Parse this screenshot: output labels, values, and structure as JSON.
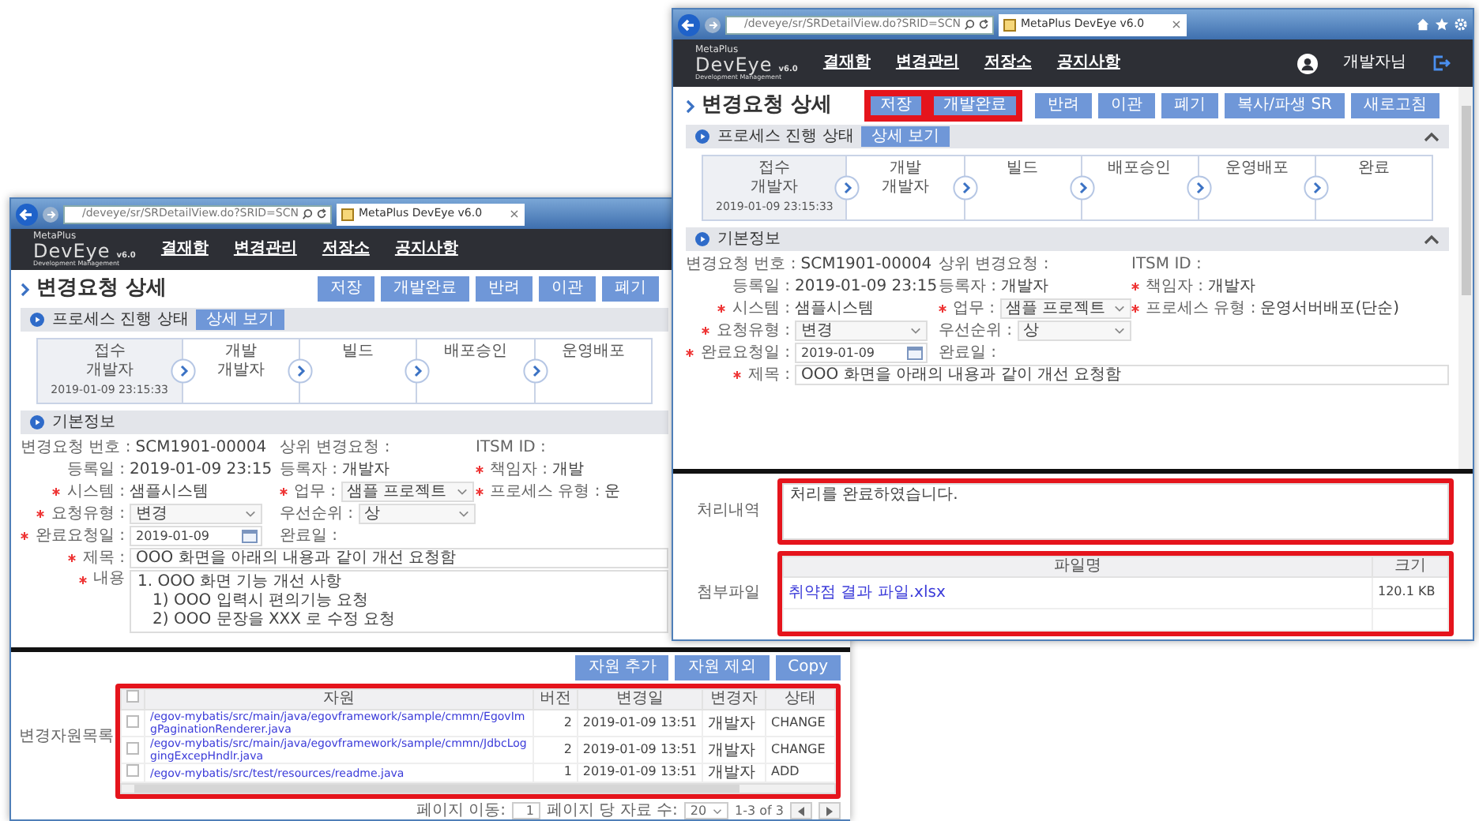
{
  "back_window": {
    "browser": {
      "url": "/deveye/sr/SRDetailView.do?SRID=SCN",
      "tab_title": "MetaPlus DevEye v6.0",
      "tab_close": "×"
    },
    "header": {
      "brand": "MetaPlus",
      "product": "DevEye",
      "version": "v6.0",
      "tagline": "Development Management",
      "menu": [
        "결재함",
        "변경관리",
        "저장소",
        "공지사항"
      ]
    },
    "page_title": "변경요청 상세",
    "actions": [
      {
        "label": "저장",
        "highlighted": false
      },
      {
        "label": "개발완료",
        "highlighted": false
      },
      {
        "label": "반려",
        "highlighted": false
      },
      {
        "label": "이관",
        "highlighted": false
      },
      {
        "label": "폐기",
        "highlighted": false
      }
    ],
    "process": {
      "title": "프로세스 진행 상태",
      "detail_button": "상세 보기",
      "collapsible": false,
      "steps": [
        {
          "name": "접수",
          "actor": "개발자",
          "time": "2019-01-09 23:15:33",
          "current": true
        },
        {
          "name": "개발",
          "actor": "개발자",
          "current": false
        },
        {
          "name": "빌드",
          "current": false
        },
        {
          "name": "배포승인",
          "current": false
        },
        {
          "name": "운영배포",
          "current": false
        }
      ]
    },
    "basic_info": {
      "title": "기본정보",
      "collapsible": false,
      "rows": [
        [
          {
            "label": "변경요청 번호 :",
            "value": "SCM1901-00004",
            "kind": "text",
            "required": false
          },
          {
            "label": "상위 변경요청 :",
            "kind": "text",
            "required": false
          },
          {
            "label": "ITSM ID :",
            "kind": "text",
            "required": false
          }
        ],
        [
          {
            "label": "등록일 :",
            "value": "2019-01-09 23:15",
            "kind": "text",
            "required": false
          },
          {
            "label": "등록자 :",
            "value": "개발자",
            "kind": "text",
            "required": false
          },
          {
            "label": "책임자 :",
            "value": "개발",
            "kind": "text",
            "required": true
          }
        ],
        [
          {
            "label": "시스템 :",
            "value": "샘플시스템",
            "kind": "text",
            "required": true
          },
          {
            "label": "업무 :",
            "value": "샘플 프로젝트",
            "kind": "select",
            "required": true
          },
          {
            "label": "프로세스 유형 :",
            "value": "운",
            "kind": "text",
            "required": true
          }
        ],
        [
          {
            "label": "요청유형 :",
            "value": "변경",
            "kind": "select",
            "required": true
          },
          {
            "label": "우선순위 :",
            "value": "상",
            "kind": "select",
            "required": false
          }
        ],
        [
          {
            "label": "완료요청일 :",
            "value": "2019-01-09",
            "kind": "date",
            "required": true
          },
          {
            "label": "완료일 :",
            "kind": "text",
            "required": false
          }
        ],
        [
          {
            "label": "제목 :",
            "value": "OOO 화면을 아래의 내용과 같이 개선 요청함",
            "kind": "input",
            "required": true
          }
        ],
        [
          {
            "label": "내용",
            "lines": [
              "1. OOO 화면 기능 개선 사항",
              "   1) OOO 입력시 편의기능 요청",
              "   2) OOO 문장을 XXX 로 수정 요청"
            ],
            "kind": "textarea",
            "required": true
          }
        ]
      ]
    },
    "resources": {
      "label": "변경자원목록",
      "buttons": [
        "자원 추가",
        "자원 제외",
        "Copy"
      ],
      "all_checked": false,
      "columns": [
        "자원",
        "버전",
        "변경일",
        "변경자",
        "상태"
      ],
      "highlighted": true,
      "rows": [
        {
          "checked": false,
          "path": "/egov-mybatis/src/main/java/egovframework/sample/cmmn/EgovImgPaginationRenderer.java",
          "version": "2",
          "changed": "2019-01-09 13:51",
          "author": "개발자",
          "status": "CHANGE"
        },
        {
          "checked": false,
          "path": "/egov-mybatis/src/main/java/egovframework/sample/cmmn/JdbcLoggingExcepHndlr.java",
          "version": "2",
          "changed": "2019-01-09 13:51",
          "author": "개발자",
          "status": "CHANGE"
        },
        {
          "checked": false,
          "path": "/egov-mybatis/src/test/resources/readme.java",
          "version": "1",
          "changed": "2019-01-09 13:51",
          "author": "개발자",
          "status": "ADD"
        }
      ],
      "pager": {
        "goto_label": "페이지 이동:",
        "page": "1",
        "per_page_label": "페이지 당 자료 수:",
        "per_page": "20",
        "range": "1-3 of 3"
      }
    }
  },
  "front_window": {
    "browser": {
      "url": "/deveye/sr/SRDetailView.do?SRID=SCN",
      "tab_title": "MetaPlus DevEye v6.0",
      "tab_close": "×"
    },
    "header": {
      "brand": "MetaPlus",
      "product": "DevEye",
      "version": "v6.0",
      "tagline": "Development Management",
      "menu": [
        "결재함",
        "변경관리",
        "저장소",
        "공지사항"
      ],
      "user": "개발자님"
    },
    "page_title": "변경요청 상세",
    "actions": [
      {
        "label": "저장",
        "highlighted": true
      },
      {
        "label": "개발완료",
        "highlighted": true
      },
      {
        "label": "반려",
        "highlighted": false
      },
      {
        "label": "이관",
        "highlighted": false
      },
      {
        "label": "폐기",
        "highlighted": false
      },
      {
        "label": "복사/파생 SR",
        "highlighted": false
      },
      {
        "label": "새로고침",
        "highlighted": false
      }
    ],
    "process": {
      "title": "프로세스 진행 상태",
      "detail_button": "상세 보기",
      "collapsible": true,
      "steps": [
        {
          "name": "접수",
          "actor": "개발자",
          "time": "2019-01-09 23:15:33",
          "current": true
        },
        {
          "name": "개발",
          "actor": "개발자",
          "current": false
        },
        {
          "name": "빌드",
          "current": false
        },
        {
          "name": "배포승인",
          "current": false
        },
        {
          "name": "운영배포",
          "current": false
        },
        {
          "name": "완료",
          "current": false
        }
      ]
    },
    "basic_info": {
      "title": "기본정보",
      "collapsible": true,
      "rows": [
        [
          {
            "label": "변경요청 번호 :",
            "value": "SCM1901-00004",
            "kind": "text",
            "required": false
          },
          {
            "label": "상위 변경요청 :",
            "kind": "text",
            "required": false
          },
          {
            "label": "ITSM ID :",
            "kind": "text",
            "required": false
          }
        ],
        [
          {
            "label": "등록일 :",
            "value": "2019-01-09 23:15",
            "kind": "text",
            "required": false
          },
          {
            "label": "등록자 :",
            "value": "개발자",
            "kind": "text",
            "required": false
          },
          {
            "label": "책임자 :",
            "value": "개발자",
            "kind": "text",
            "required": true
          }
        ],
        [
          {
            "label": "시스템 :",
            "value": "샘플시스템",
            "kind": "text",
            "required": true
          },
          {
            "label": "업무 :",
            "value": "샘플 프로젝트",
            "kind": "select",
            "required": true
          },
          {
            "label": "프로세스 유형 :",
            "value": "운영서버배포(단순)",
            "kind": "text",
            "required": true
          }
        ],
        [
          {
            "label": "요청유형 :",
            "value": "변경",
            "kind": "select",
            "required": true
          },
          {
            "label": "우선순위 :",
            "value": "상",
            "kind": "select",
            "required": false
          }
        ],
        [
          {
            "label": "완료요청일 :",
            "value": "2019-01-09",
            "kind": "date",
            "required": true
          },
          {
            "label": "완료일 :",
            "kind": "text",
            "required": false
          }
        ],
        [
          {
            "label": "제목 :",
            "value": "OOO 화면을 아래의 내용과 같이 개선 요청함",
            "kind": "input",
            "required": true
          }
        ]
      ]
    },
    "result": {
      "label": "처리내역",
      "text": "처리를 완료하였습니다.",
      "highlighted": true
    },
    "attachments": {
      "label": "첨부파일",
      "columns": [
        "파일명",
        "크기"
      ],
      "highlighted": true,
      "rows": [
        {
          "name": "취약점 결과 파일.xlsx",
          "size": "120.1 KB"
        }
      ]
    }
  }
}
